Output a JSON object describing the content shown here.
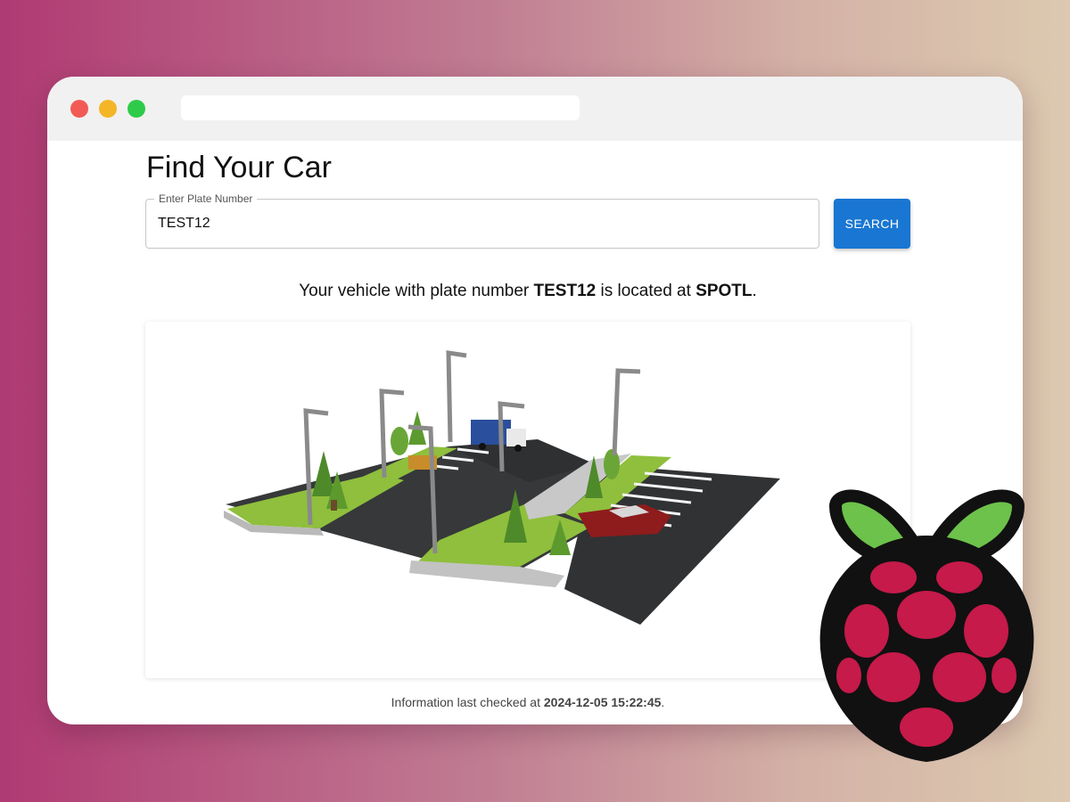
{
  "page": {
    "title": "Find Your Car"
  },
  "search": {
    "label": "Enter Plate Number",
    "value": "TEST12",
    "button_label": "SEARCH"
  },
  "result": {
    "prefix": "Your vehicle with plate number ",
    "plate": "TEST12",
    "middle": " is located at ",
    "spot": "SPOTL",
    "suffix": "."
  },
  "footer": {
    "prefix": "Information last checked at ",
    "timestamp": "2024-12-05 15:22:45",
    "suffix": "."
  },
  "icons": {
    "logo": "raspberry-pi-logo",
    "map": "parking-lot-3d-map"
  },
  "colors": {
    "accent": "#1976d2",
    "window_dots": [
      "#f25b55",
      "#f4b527",
      "#2ecb4b"
    ],
    "raspberry_leaf": "#6cc24a",
    "raspberry_berry": "#c51a4a"
  }
}
